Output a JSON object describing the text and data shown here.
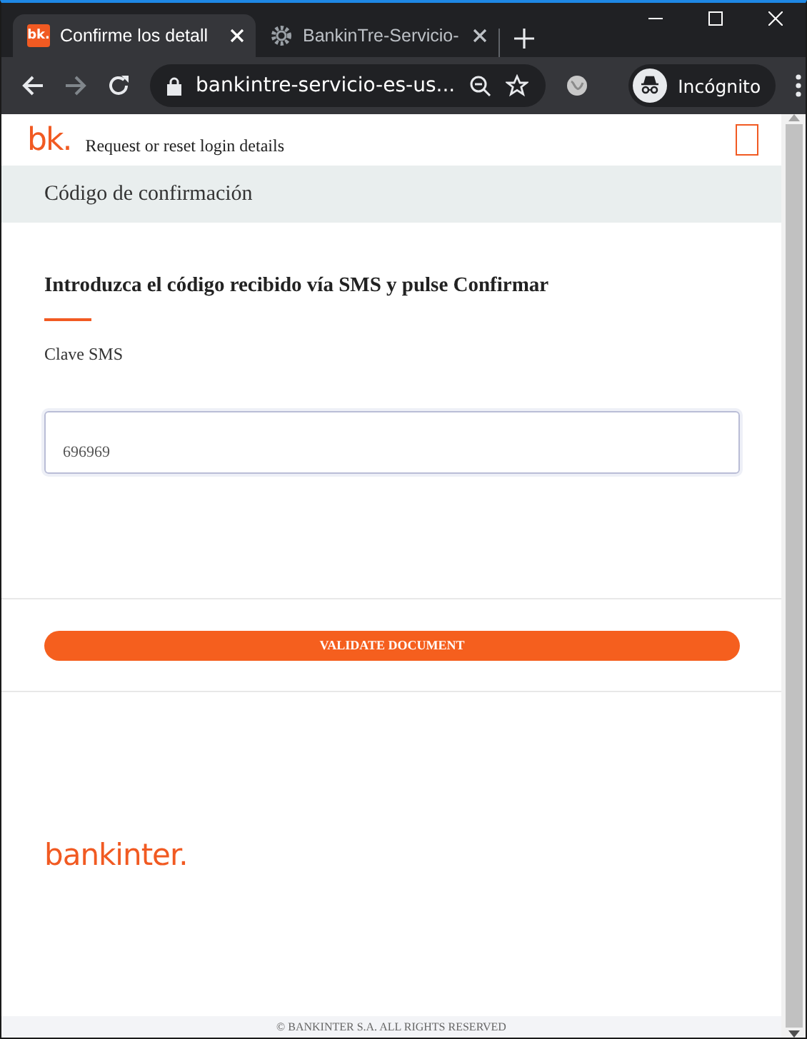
{
  "browser": {
    "tabs": [
      {
        "title": "Confirme los detall",
        "favicon": "bk.",
        "selected": true
      },
      {
        "title": "BankinTre-Servicio-",
        "selected": false
      }
    ],
    "address": "bankintre-servicio-es-us...",
    "profile": "Incógnito"
  },
  "page": {
    "logo": "bk.",
    "header_title": "Request or reset login details",
    "section_title": "Código de confirmación",
    "heading": "Introduzca el código recibido vía SMS y pulse Confirmar",
    "field_label": "Clave SMS",
    "field_value": "696969",
    "button": "VALIDATE DOCUMENT",
    "footer_logo": "bankinter.",
    "copyright": "© BANKINTER S.A. ALL RIGHTS RESERVED"
  }
}
